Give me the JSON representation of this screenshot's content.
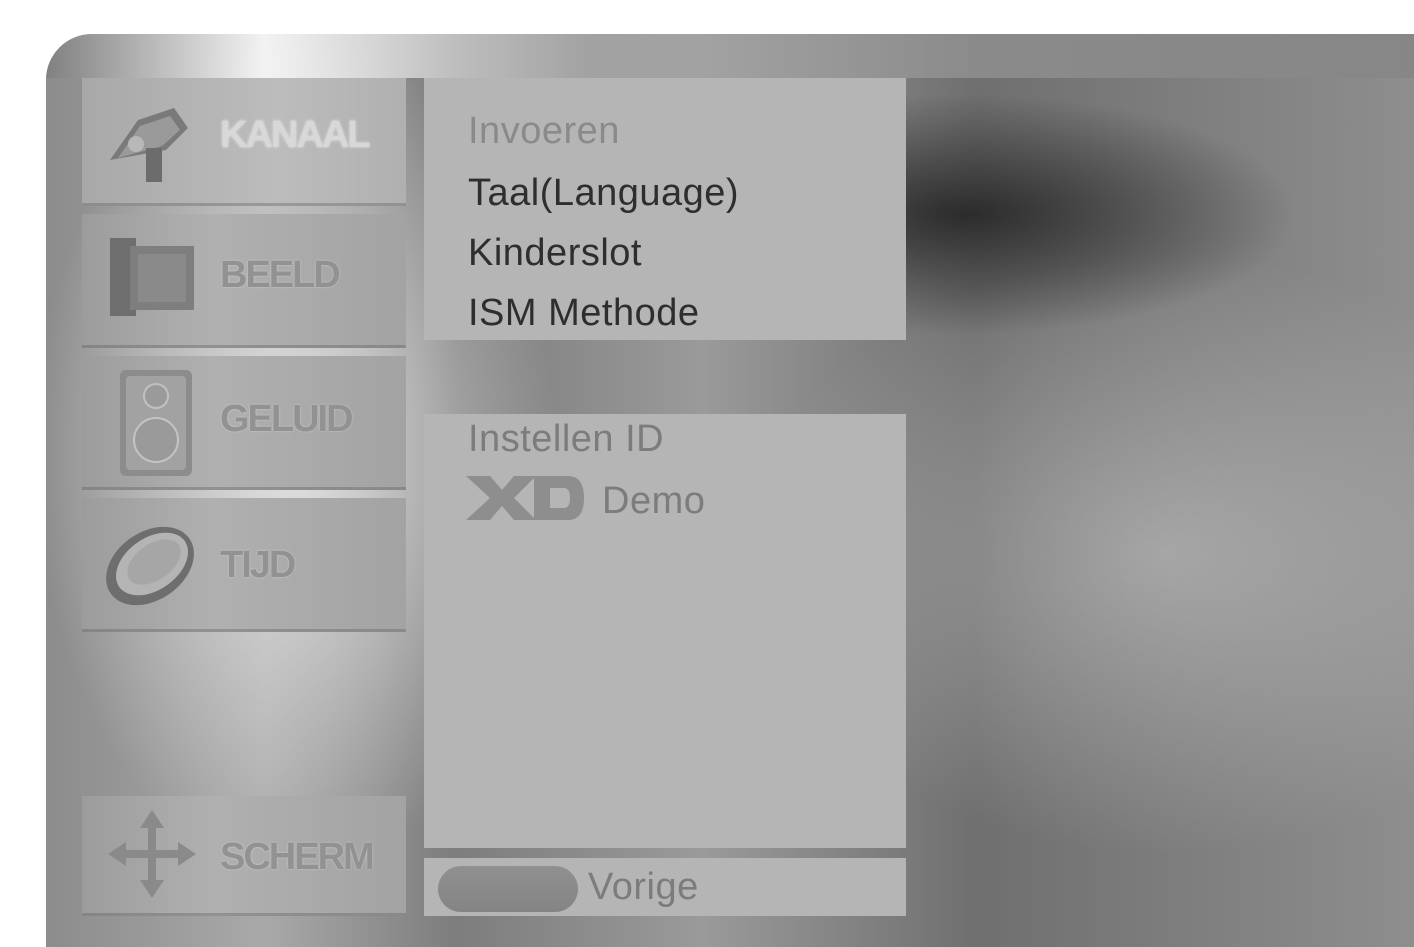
{
  "sidebar": {
    "items": [
      {
        "label": "KANAAL",
        "icon": "satellite-dish-icon",
        "active": true
      },
      {
        "label": "BEELD",
        "icon": "picture-icon",
        "active": false
      },
      {
        "label": "GELUID",
        "icon": "speaker-icon",
        "active": false
      },
      {
        "label": "TIJD",
        "icon": "clock-icon",
        "active": false
      },
      {
        "label": "SCHERM",
        "icon": "move-arrows-icon",
        "active": false
      }
    ]
  },
  "submenu": {
    "items": [
      {
        "label": "Invoeren"
      },
      {
        "label": "Taal(Language)"
      },
      {
        "label": "Kinderslot"
      },
      {
        "label": "ISM Methode"
      }
    ]
  },
  "lower_panel": {
    "items": [
      {
        "label": "Instellen ID"
      }
    ],
    "xd_demo": {
      "logo": "XD",
      "label": "Demo"
    }
  },
  "footer": {
    "back_label": "Vorige"
  },
  "colors": {
    "panel": "#b5b5b5",
    "text_active": "#2e2e2e",
    "text_dim": "#8a8a8a",
    "sidebar_label": "#929292"
  }
}
